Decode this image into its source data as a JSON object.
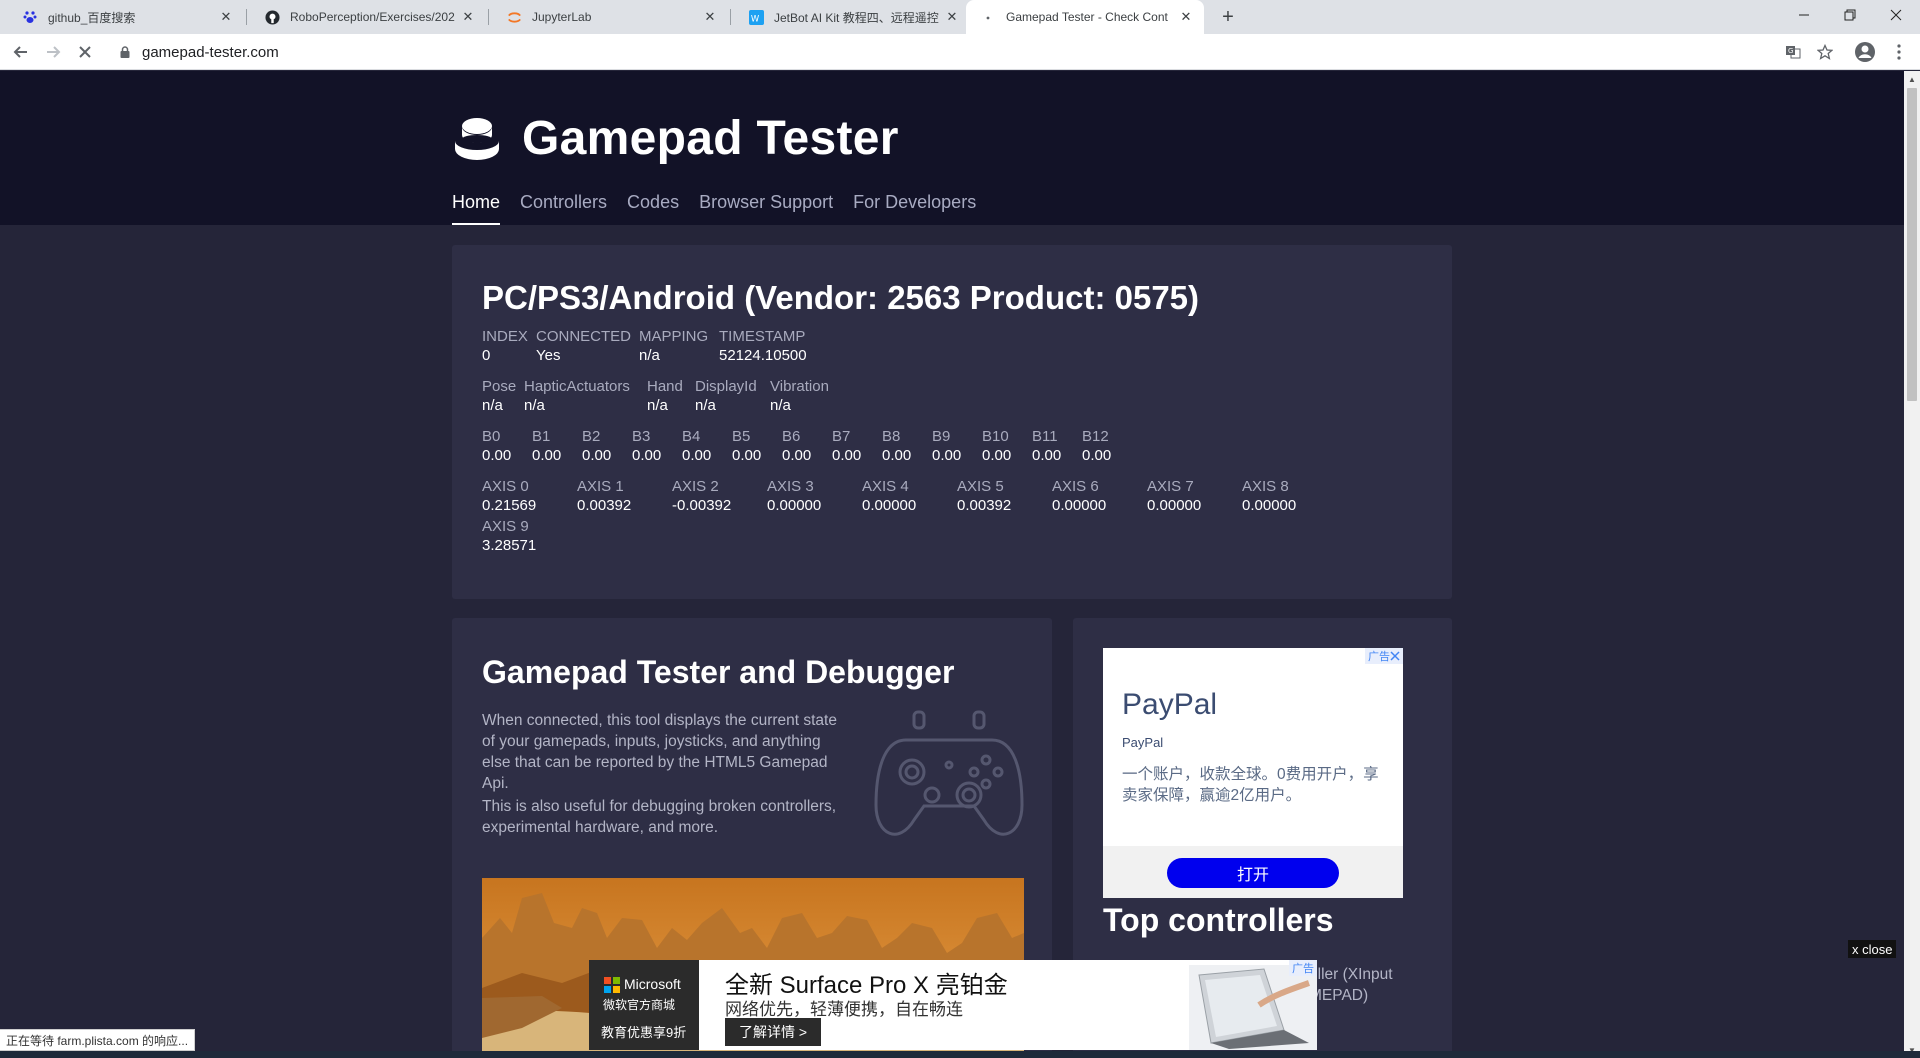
{
  "browser": {
    "tabs": [
      {
        "title": "github_百度搜索",
        "favicon": "baidu-paw-icon"
      },
      {
        "title": "RoboPerception/Exercises/202",
        "favicon": "github-icon"
      },
      {
        "title": "JupyterLab",
        "favicon": "jupyter-icon"
      },
      {
        "title": "JetBot AI Kit 教程四、远程遥控",
        "favicon": "waveshare-icon"
      },
      {
        "title": "Gamepad Tester - Check Cont",
        "favicon": "loading-dot-icon",
        "active": true
      }
    ],
    "url": "gamepad-tester.com",
    "status_text": "正在等待 farm.plista.com 的响应..."
  },
  "site": {
    "name": "Gamepad Tester",
    "nav": [
      "Home",
      "Controllers",
      "Codes",
      "Browser Support",
      "For Developers"
    ],
    "active_nav": "Home"
  },
  "gamepad": {
    "title": "PC/PS3/Android (Vendor: 2563 Product: 0575)",
    "meta": [
      {
        "label": "INDEX",
        "value": "0"
      },
      {
        "label": "CONNECTED",
        "value": "Yes"
      },
      {
        "label": "MAPPING",
        "value": "n/a"
      },
      {
        "label": "TIMESTAMP",
        "value": "52124.10500"
      }
    ],
    "extras": [
      {
        "label": "Pose",
        "value": "n/a"
      },
      {
        "label": "HapticActuators",
        "value": "n/a"
      },
      {
        "label": "Hand",
        "value": "n/a"
      },
      {
        "label": "DisplayId",
        "value": "n/a"
      },
      {
        "label": "Vibration",
        "value": "n/a"
      }
    ],
    "buttons": [
      {
        "label": "B0",
        "value": "0.00"
      },
      {
        "label": "B1",
        "value": "0.00"
      },
      {
        "label": "B2",
        "value": "0.00"
      },
      {
        "label": "B3",
        "value": "0.00"
      },
      {
        "label": "B4",
        "value": "0.00"
      },
      {
        "label": "B5",
        "value": "0.00"
      },
      {
        "label": "B6",
        "value": "0.00"
      },
      {
        "label": "B7",
        "value": "0.00"
      },
      {
        "label": "B8",
        "value": "0.00"
      },
      {
        "label": "B9",
        "value": "0.00"
      },
      {
        "label": "B10",
        "value": "0.00"
      },
      {
        "label": "B11",
        "value": "0.00"
      },
      {
        "label": "B12",
        "value": "0.00"
      }
    ],
    "axes": [
      {
        "label": "AXIS 0",
        "value": "0.21569"
      },
      {
        "label": "AXIS 1",
        "value": "0.00392"
      },
      {
        "label": "AXIS 2",
        "value": "-0.00392"
      },
      {
        "label": "AXIS 3",
        "value": "0.00000"
      },
      {
        "label": "AXIS 4",
        "value": "0.00000"
      },
      {
        "label": "AXIS 5",
        "value": "0.00392"
      },
      {
        "label": "AXIS 6",
        "value": "0.00000"
      },
      {
        "label": "AXIS 7",
        "value": "0.00000"
      },
      {
        "label": "AXIS 8",
        "value": "0.00000"
      },
      {
        "label": "AXIS 9",
        "value": "3.28571"
      }
    ]
  },
  "info": {
    "title": "Gamepad Tester and Debugger",
    "p1": "When connected, this tool displays the current state of your gamepads, inputs, joysticks, and anything else that can be reported by the HTML5 Gamepad Api.",
    "p2": "This is also useful for debugging broken controllers, experimental hardware, and more."
  },
  "side": {
    "ad": {
      "badge": "广告",
      "brand_big": "PayPal",
      "brand_small": "PayPal",
      "text": "一个账户，收款全球。0费用开户，享卖家保障，赢逾2亿用户。",
      "button": "打开"
    },
    "top_controllers_title": "Top controllers",
    "partial_lines": [
      "oller (XInput",
      "MEPAD)"
    ]
  },
  "banner_ad": {
    "brand": "Microsoft",
    "store": "微软官方商城",
    "edu": "教育优惠享9折",
    "headline": "全新 Surface Pro X 亮铂金",
    "subline": "网络优先，轻薄便携，自在畅连",
    "cta": "了解详情 >",
    "badge": "广告",
    "close": "x close"
  },
  "colors": {
    "header_bg": "#121227",
    "page_bg": "#252539",
    "card_bg": "#2e2e45",
    "label": "#a9abbe",
    "value": "#ffffff",
    "paypal_button": "#0000ee"
  }
}
